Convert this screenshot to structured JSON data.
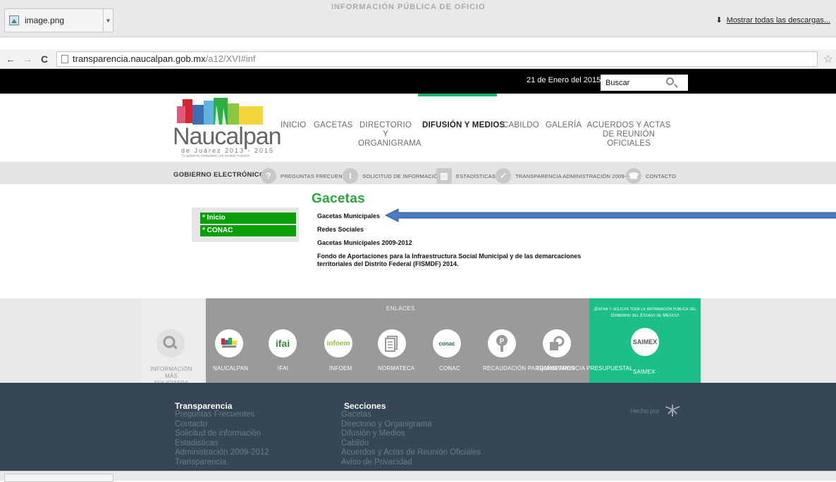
{
  "browser": {
    "download_file": "image.png",
    "show_all_downloads": "Mostrar todas las descargas...",
    "url_host": "transparencia.naucalpan.gob.mx",
    "url_path": "/a12/XVI#inf",
    "ghost_title": "INFORMACIÓN PÚBLICA DE OFICIO"
  },
  "topbar": {
    "date": "21 de Enero del 2015",
    "search_placeholder": "Buscar"
  },
  "logo": {
    "brand": "Naucalpan",
    "tagline": "de Juárez 2013 - 2015",
    "slogan": "Tu gobierno ciudadano con sentido humano"
  },
  "main_nav": [
    {
      "label": "INICIO"
    },
    {
      "label": "GACETAS"
    },
    {
      "label": "DIRECTORIO Y ORGANIGRAMA"
    },
    {
      "label": "DIFUSIÓN Y MEDIOS"
    },
    {
      "label": "CABILDO"
    },
    {
      "label": "GALERÍA"
    },
    {
      "label": "ACUERDOS Y ACTAS DE REUNIÓN OFICIALES"
    }
  ],
  "sub_nav": {
    "gob": "GOBIERNO ELECTRÓNICO",
    "items": [
      {
        "label": "Preguntas Frecuentes",
        "icon": "question-icon"
      },
      {
        "label": "Solicitud de Información",
        "icon": "info-icon"
      },
      {
        "label": "Estadísticas",
        "icon": "chart-icon"
      },
      {
        "label": "Transparencia Administración 2009-2012",
        "icon": "check-icon"
      },
      {
        "label": "Contacto",
        "icon": "phone-icon"
      }
    ]
  },
  "content": {
    "title": "Gacetas",
    "side_buttons": [
      "* Inicio",
      "* CONAC"
    ],
    "links": [
      "Gacetas Municipales",
      "Redes Sociales",
      "Gacetas Municipales 2009-2012",
      "Fondo de Aportaciones para la Infraestructura Social Municipal y de las demarcaciones territoriales del Distrito Federal (FISMDF) 2014."
    ]
  },
  "enlaces": {
    "label": "ENLACES",
    "first_label": "INFORMACIÓN MÁS SOLICITADA",
    "items": [
      {
        "label": "NAUCALPAN"
      },
      {
        "label": "IFAI"
      },
      {
        "label": "INFOEM"
      },
      {
        "label": "NORMATECA"
      },
      {
        "label": "CONAC"
      },
      {
        "label": "RECAUDACIÓN PARQUÍMETROS"
      },
      {
        "label": "TRANSPARENCIA PRESUPUESTAL"
      }
    ],
    "saimex_text": "¡Entra y solicita toda la información pública del Gobierno del Estado de México!",
    "saimex_label": "SAIMEX",
    "saimex_logo": "SAIMEX"
  },
  "footer": {
    "col1_title": "Transparencia",
    "col1": [
      "Preguntas Frecuentes",
      "Contacto",
      "Solicitud de información",
      "Estadisticas",
      "Administración 2009-2012",
      "Transparencia"
    ],
    "col2_title": "Secciones",
    "col2": [
      "Gacetas",
      "Directorio y Organigrama",
      "Difusión y Medios",
      "Cabildo",
      "Acuerdos y Actas de Reunión Oficiales",
      "Aviso de Privacidad"
    ],
    "hecho": "Hecho por"
  },
  "colors": {
    "accent_green": "#2aa43b",
    "button_green": "#0aa00a",
    "saimex_green": "#1cbf8a",
    "footer_bg": "#364656"
  }
}
